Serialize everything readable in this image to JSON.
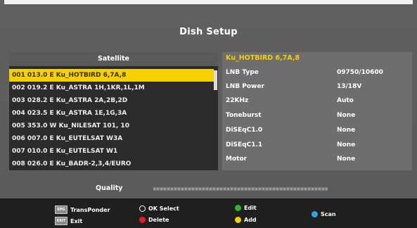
{
  "screen": {
    "title": "Dish Setup"
  },
  "satellite_panel": {
    "header": "Satellite",
    "selected_index": 0,
    "items": [
      "001 013.0 E  Ku_HOTBIRD 6,7A,8",
      "002 019.2 E  Ku_ASTRA 1H,1KR,1L,1M",
      "003 028.2 E  Ku_ASTRA 2A,2B,2D",
      "004 023.5 E  Ku_ASTRA 1E,1G,3A",
      "005 353.0 W  Ku_NILESAT 101, 10",
      "006 007.0 E  Ku_EUTELSAT W3A",
      "007 010.0 E  Ku_EUTELSAT W1",
      "008 026.0 E  Ku_BADR-2,3,4/EURO"
    ]
  },
  "details": {
    "title": "Ku_HOTBIRD 6,7A,8",
    "rows": [
      {
        "key": "LNB Type",
        "value": "09750/10600"
      },
      {
        "key": "LNB Power",
        "value": "13/18V"
      },
      {
        "key": "22KHz",
        "value": "Auto"
      },
      {
        "key": "Toneburst",
        "value": "None"
      },
      {
        "key": "DiSEqC1.0",
        "value": "None"
      },
      {
        "key": "DiSEqC1.1",
        "value": "None"
      },
      {
        "key": "Motor",
        "value": "None"
      }
    ]
  },
  "quality": {
    "label": "Quality",
    "level": 0
  },
  "footer": {
    "transponder": "TransPonder",
    "exit": "Exit",
    "ok_select": "OK Select",
    "delete": "Delete",
    "edit": "Edit",
    "add": "Add",
    "scan": "Scan",
    "key_epg": "EPG",
    "key_exit": "EXIT"
  },
  "colors": {
    "selection": "#f6d000",
    "red": "#e02020",
    "green": "#2fb52f",
    "yellow": "#f0d000",
    "blue": "#2aa6e0"
  }
}
